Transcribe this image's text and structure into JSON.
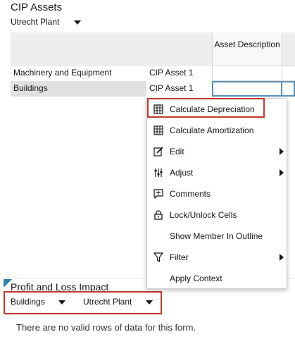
{
  "top_panel": {
    "title": "CIP Assets",
    "pov": {
      "selected": "Utrecht Plant"
    }
  },
  "grid": {
    "column_header": "Asset Description",
    "rows": [
      {
        "member": "Machinery and Equipment",
        "asset": "CIP Asset 1"
      },
      {
        "member": "Buildings",
        "asset": "CIP Asset 1"
      }
    ]
  },
  "context_menu": {
    "items": [
      {
        "label": "Calculate Depreciation",
        "icon": "grid-icon"
      },
      {
        "label": "Calculate Amortization",
        "icon": "grid-icon"
      },
      {
        "label": "Edit",
        "icon": "edit-icon",
        "submenu": true
      },
      {
        "label": "Adjust",
        "icon": "adjust-icon",
        "submenu": true
      },
      {
        "label": "Comments",
        "icon": "comment-icon"
      },
      {
        "label": "Lock/Unlock Cells",
        "icon": "lock-icon"
      },
      {
        "label": "Show Member In Outline",
        "icon": ""
      },
      {
        "label": "Filter",
        "icon": "filter-icon",
        "submenu": true
      },
      {
        "label": "Apply Context",
        "icon": ""
      }
    ]
  },
  "bottom_panel": {
    "title": "Profit and Loss Impact",
    "pov": [
      "Buildings",
      "Utrecht Plant"
    ],
    "empty_message": "There are no valid rows of data for this form."
  },
  "colors": {
    "highlight": "#c0392b",
    "selection": "#5b8fb3",
    "panel_marker": "#2f7fae"
  }
}
